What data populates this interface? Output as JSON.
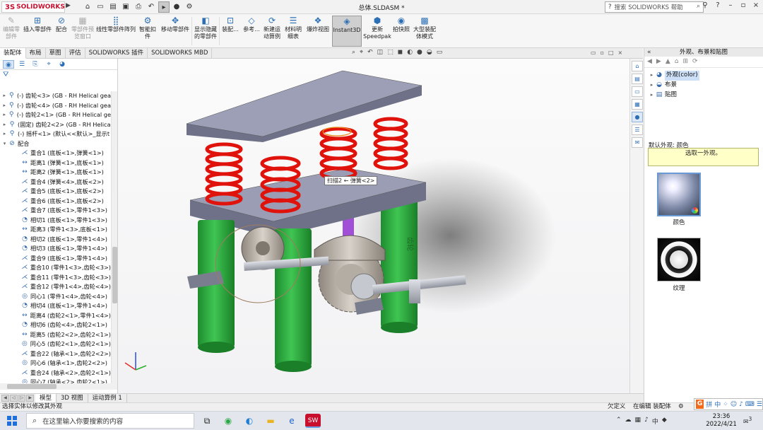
{
  "app": {
    "brand": "SOLIDWORKS",
    "brand_prefix": "3S",
    "document_title": "总体.SLDASM *"
  },
  "help": {
    "placeholder": "搜索 SOLIDWORKS 帮助"
  },
  "quick_access": [
    "home-icon",
    "new-icon",
    "open-icon",
    "save-icon",
    "print-icon",
    "undo-icon",
    "select-icon",
    "rebuild-icon",
    "options-icon"
  ],
  "ribbon": {
    "buttons": [
      {
        "label": "编辑零部件",
        "icon": "edit-component-icon",
        "disabled": true
      },
      {
        "label": "插入零部件",
        "icon": "insert-component-icon"
      },
      {
        "label": "配合",
        "icon": "mate-icon"
      },
      {
        "label": "零部件预览窗口",
        "icon": "preview-icon",
        "disabled": true
      },
      {
        "label": "线性零部件阵列",
        "icon": "pattern-icon"
      },
      {
        "label": "智能扣件",
        "icon": "fastener-icon"
      },
      {
        "label": "移动零部件",
        "icon": "move-icon"
      },
      {
        "label": "显示隐藏的零部件",
        "icon": "show-hidden-icon"
      },
      {
        "label": "装配...",
        "icon": "assembly-feature-icon"
      },
      {
        "label": "参考...",
        "icon": "reference-icon"
      },
      {
        "label": "新建运动算例",
        "icon": "motion-study-icon"
      },
      {
        "label": "材料明细表",
        "icon": "bom-icon"
      },
      {
        "label": "爆炸视图",
        "icon": "explode-icon"
      },
      {
        "label": "Instant3D",
        "icon": "instant3d-icon",
        "active": true
      },
      {
        "label": "更新Speedpak",
        "icon": "speedpak-icon"
      },
      {
        "label": "拍快照",
        "icon": "snapshot-icon"
      },
      {
        "label": "大型装配体模式",
        "icon": "large-assembly-icon"
      }
    ]
  },
  "command_tabs": [
    {
      "label": "装配体",
      "active": true
    },
    {
      "label": "布局"
    },
    {
      "label": "草图"
    },
    {
      "label": "评估"
    },
    {
      "label": "SOLIDWORKS 插件"
    },
    {
      "label": "SOLIDWORKS MBD"
    }
  ],
  "tree": {
    "filter_icon": "filter-icon",
    "items": [
      {
        "text": "(-) 齿轮<3> (GB - RH Helical gea",
        "icon": "part-icon",
        "expand": "▸"
      },
      {
        "text": "(-) 齿轮<4> (GB - RH Helical gea",
        "icon": "part-icon",
        "expand": "▸"
      },
      {
        "text": "(-) 齿轮2<1> (GB - RH Helical ge",
        "icon": "part-icon",
        "expand": "▸"
      },
      {
        "text": "(固定) 齿轮2<2> (GB - RH Helica",
        "icon": "part-icon",
        "expand": "▸"
      },
      {
        "text": "(-) 摇杆<1> (默认<<默认>_显示t",
        "icon": "part-icon",
        "expand": "▸"
      },
      {
        "text": "配合",
        "icon": "mates-folder-icon",
        "expand": "▾"
      },
      {
        "text": "重合1 (底板<1>,弹簧<1>)",
        "icon": "coincident-icon"
      },
      {
        "text": "距离1 (弹簧<1>,底板<1>)",
        "icon": "distance-icon"
      },
      {
        "text": "距离2 (弹簧<1>,底板<1>)",
        "icon": "distance-icon"
      },
      {
        "text": "重合4 (弹簧<4>,底板<2>)",
        "icon": "coincident-icon"
      },
      {
        "text": "重合5 (底板<1>,底板<2>)",
        "icon": "coincident-icon"
      },
      {
        "text": "重合6 (底板<1>,底板<2>)",
        "icon": "coincident-icon"
      },
      {
        "text": "重合7 (底板<1>,零件1<3>)",
        "icon": "coincident-icon"
      },
      {
        "text": "相切1 (底板<1>,零件1<3>)",
        "icon": "tangent-icon"
      },
      {
        "text": "距离3 (零件1<3>,底板<1>)",
        "icon": "distance-icon"
      },
      {
        "text": "相切2 (底板<1>,零件1<4>)",
        "icon": "tangent-icon"
      },
      {
        "text": "相切3 (底板<1>,零件1<4>)",
        "icon": "tangent-icon"
      },
      {
        "text": "重合9 (底板<1>,零件1<4>)",
        "icon": "coincident-icon"
      },
      {
        "text": "重合10 (零件1<3>,齿轮<3>)",
        "icon": "coincident-icon"
      },
      {
        "text": "重合11 (零件1<3>,齿轮<3>)",
        "icon": "coincident-icon"
      },
      {
        "text": "重合12 (零件1<4>,齿轮<4>)",
        "icon": "coincident-icon"
      },
      {
        "text": "同心1 (零件1<4>,齿轮<4>)",
        "icon": "concentric-icon"
      },
      {
        "text": "相切4 (底板<1>,零件1<4>)",
        "icon": "tangent-icon"
      },
      {
        "text": "距离4 (齿轮2<1>,零件1<4>)",
        "icon": "distance-icon"
      },
      {
        "text": "相切6 (齿轮<4>,齿轮2<1>)",
        "icon": "tangent-icon"
      },
      {
        "text": "距离5 (齿轮2<2>,齿轮2<1>)",
        "icon": "distance-icon"
      },
      {
        "text": "同心5 (齿轮2<1>,齿轮2<1>)",
        "icon": "concentric-icon"
      },
      {
        "text": "重合22 (轴承<1>,齿轮2<2>)",
        "icon": "coincident-icon"
      },
      {
        "text": "同心6 (轴承<1>,齿轮2<2>)",
        "icon": "concentric-icon"
      },
      {
        "text": "重合24 (轴承<2>,齿轮2<1>)",
        "icon": "coincident-icon"
      },
      {
        "text": "同心7 (轴承<2>,齿轮2<1>)",
        "icon": "concentric-icon"
      }
    ]
  },
  "viewport": {
    "tooltip": "扫描2 ← 弹簧<2>",
    "gear_text": "齿轮",
    "colors": {
      "plate": "#8d8fa6",
      "spring": "#e0120c",
      "leg": "#27a43a",
      "gear": "#b8b0a6",
      "shaft": "#b9bcc4",
      "purple": "#a14fd6"
    }
  },
  "bottom_tabs": [
    {
      "label": "模型",
      "active": true
    },
    {
      "label": "3D 视图"
    },
    {
      "label": "运动算例 1"
    }
  ],
  "task_pane": {
    "title": "外观、布景和贴图",
    "tree": [
      {
        "label": "外观(color)",
        "icon": "appearance-icon",
        "selected": true
      },
      {
        "label": "布景",
        "icon": "scene-icon"
      },
      {
        "label": "贴图",
        "icon": "decal-icon"
      }
    ],
    "default_label": "默认外观: 颜色",
    "hint": "选取一外观。",
    "swatches": [
      {
        "label": "颜色"
      },
      {
        "label": "纹理"
      }
    ]
  },
  "status": {
    "message": "选择实体以修改其外观",
    "mode_a": "欠定义",
    "mode_b": "在编辑 装配体"
  },
  "taskbar": {
    "search_placeholder": "在这里输入你要搜索的内容",
    "time": "23:36",
    "date": "2022/4/21",
    "notif_count": "3"
  },
  "ime": {
    "g": "G",
    "labels": [
      "拼",
      "中"
    ]
  }
}
